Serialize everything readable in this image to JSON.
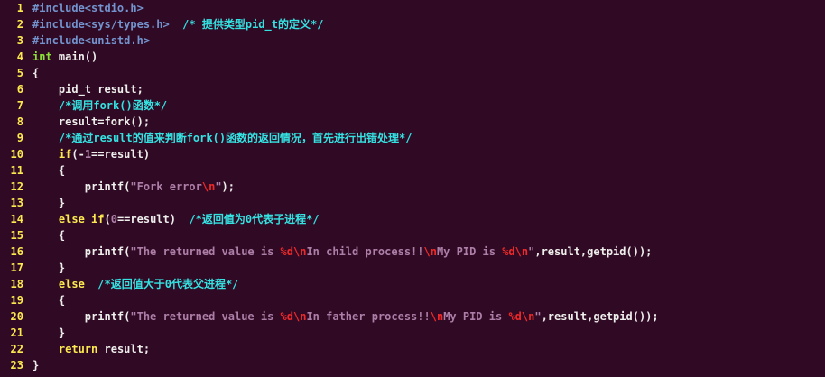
{
  "editor": {
    "colors": {
      "background": "#300a24",
      "line_number": "#fce94f",
      "preprocessor": "#7394cf",
      "type": "#8ae234",
      "keyword": "#fce94f",
      "comment": "#34e2e2",
      "string": "#ad7fa8",
      "special": "#ef2929",
      "text": "#eeeeec"
    },
    "lines": [
      {
        "num": "1",
        "tokens": [
          [
            "pp",
            "#include<stdio.h>"
          ]
        ]
      },
      {
        "num": "2",
        "tokens": [
          [
            "pp",
            "#include<sys/types.h>"
          ],
          [
            "n",
            "  "
          ],
          [
            "c",
            "/* 提供类型pid_t的定义*/"
          ]
        ]
      },
      {
        "num": "3",
        "tokens": [
          [
            "pp",
            "#include<unistd.h>"
          ]
        ]
      },
      {
        "num": "4",
        "tokens": [
          [
            "ty",
            "int"
          ],
          [
            "n",
            " main()"
          ]
        ]
      },
      {
        "num": "5",
        "tokens": [
          [
            "n",
            "{"
          ]
        ]
      },
      {
        "num": "6",
        "tokens": [
          [
            "n",
            "    pid_t result;"
          ]
        ]
      },
      {
        "num": "7",
        "tokens": [
          [
            "n",
            "    "
          ],
          [
            "c",
            "/*调用fork()函数*/"
          ]
        ]
      },
      {
        "num": "8",
        "tokens": [
          [
            "n",
            "    result=fork();"
          ]
        ]
      },
      {
        "num": "9",
        "tokens": [
          [
            "n",
            "    "
          ],
          [
            "c",
            "/*通过result的值来判断fork()函数的返回情况，首先进行出错处理*/"
          ]
        ]
      },
      {
        "num": "10",
        "tokens": [
          [
            "n",
            "    "
          ],
          [
            "kw",
            "if"
          ],
          [
            "n",
            "(-"
          ],
          [
            "num",
            "1"
          ],
          [
            "n",
            "==result)"
          ]
        ]
      },
      {
        "num": "11",
        "tokens": [
          [
            "n",
            "    {"
          ]
        ]
      },
      {
        "num": "12",
        "tokens": [
          [
            "n",
            "        printf("
          ],
          [
            "s",
            "\"Fork error"
          ],
          [
            "sp",
            "\\n"
          ],
          [
            "s",
            "\""
          ],
          [
            "n",
            ");"
          ]
        ]
      },
      {
        "num": "13",
        "tokens": [
          [
            "n",
            "    }"
          ]
        ]
      },
      {
        "num": "14",
        "tokens": [
          [
            "n",
            "    "
          ],
          [
            "kw",
            "else if"
          ],
          [
            "n",
            "("
          ],
          [
            "num",
            "0"
          ],
          [
            "n",
            "==result)  "
          ],
          [
            "c",
            "/*返回值为0代表子进程*/"
          ]
        ]
      },
      {
        "num": "15",
        "tokens": [
          [
            "n",
            "    {"
          ]
        ]
      },
      {
        "num": "16",
        "tokens": [
          [
            "n",
            "        printf("
          ],
          [
            "s",
            "\"The returned value is "
          ],
          [
            "sp",
            "%d\\n"
          ],
          [
            "s",
            "In child process!!"
          ],
          [
            "sp",
            "\\n"
          ],
          [
            "s",
            "My PID is "
          ],
          [
            "sp",
            "%d\\n"
          ],
          [
            "s",
            "\""
          ],
          [
            "n",
            ",result,getpid());"
          ]
        ]
      },
      {
        "num": "17",
        "tokens": [
          [
            "n",
            "    }"
          ]
        ]
      },
      {
        "num": "18",
        "tokens": [
          [
            "n",
            "    "
          ],
          [
            "kw",
            "else"
          ],
          [
            "n",
            "  "
          ],
          [
            "c",
            "/*返回值大于0代表父进程*/"
          ]
        ]
      },
      {
        "num": "19",
        "tokens": [
          [
            "n",
            "    {"
          ]
        ]
      },
      {
        "num": "20",
        "tokens": [
          [
            "n",
            "        printf("
          ],
          [
            "s",
            "\"The returned value is "
          ],
          [
            "sp",
            "%d\\n"
          ],
          [
            "s",
            "In father process!!"
          ],
          [
            "sp",
            "\\n"
          ],
          [
            "s",
            "My PID is "
          ],
          [
            "sp",
            "%d\\n"
          ],
          [
            "s",
            "\""
          ],
          [
            "n",
            ",result,getpid());"
          ]
        ]
      },
      {
        "num": "21",
        "tokens": [
          [
            "n",
            "    }"
          ]
        ]
      },
      {
        "num": "22",
        "tokens": [
          [
            "n",
            "    "
          ],
          [
            "kw",
            "return"
          ],
          [
            "n",
            " result;"
          ]
        ]
      },
      {
        "num": "23",
        "tokens": [
          [
            "n",
            "}"
          ]
        ]
      }
    ]
  }
}
